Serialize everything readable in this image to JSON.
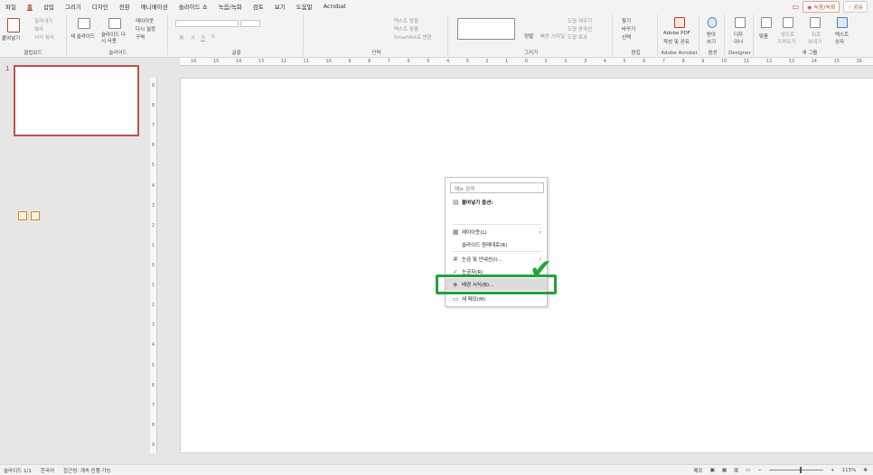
{
  "menu": {
    "tabs": [
      "파일",
      "홈",
      "삽입",
      "그리기",
      "디자인",
      "전환",
      "애니메이션",
      "슬라이드 쇼",
      "녹음/녹화",
      "검토",
      "보기",
      "도움말",
      "Acrobat"
    ],
    "active_index": 1,
    "record_button": "◉ 녹음/녹화",
    "share_button": "☝ 공유",
    "comment_icon": "comment-icon"
  },
  "ribbon": {
    "clipboard": {
      "paste": "붙여넣기",
      "cut": "잘라내기",
      "copy": "복사",
      "format_painter": "서식 복사",
      "label": "클립보드"
    },
    "slides": {
      "new_slide": "새 슬라이드",
      "reuse": "슬라이드 다시 사용",
      "layout": "레이아웃",
      "reset": "다시 설정",
      "section": "구역",
      "label": "슬라이드"
    },
    "font": {
      "label": "글꼴",
      "bold": "가",
      "italic": "가",
      "underline": "가",
      "strike": "S"
    },
    "paragraph": {
      "text_direction": "텍스트 방향",
      "align_text": "텍스트 맞춤",
      "smartart": "SmartArt로 변환",
      "label": "단락"
    },
    "drawing": {
      "arrange": "정렬",
      "quick_styles": "빠른 스타일",
      "shape_fill": "도형 채우기",
      "shape_outline": "도형 윤곽선",
      "shape_effects": "도형 효과",
      "label": "그리기"
    },
    "editing": {
      "find": "찾기",
      "replace": "바꾸기",
      "select": "선택",
      "label": "편집"
    },
    "acrobat": {
      "create_pdf": "Adobe PDF",
      "create_share": "작성 및 공유",
      "label": "Adobe Acrobat"
    },
    "voice": {
      "dictate": "받아",
      "dictate2": "쓰기",
      "label": "음성"
    },
    "designer": {
      "designer": "디자",
      "designer2": "이너",
      "label": "Designer"
    },
    "new_group": {
      "fit": "맞춤",
      "bring_forward": "앞으로",
      "bring_forward2": "가져오기",
      "send_back": "뒤로",
      "send_back2": "보내기",
      "textbox": "텍스트",
      "textbox2": "상자",
      "label": "새 그룹"
    }
  },
  "ruler_h": [
    "16",
    "15",
    "14",
    "13",
    "12",
    "11",
    "10",
    "9",
    "8",
    "7",
    "6",
    "5",
    "4",
    "3",
    "2",
    "1",
    "0",
    "1",
    "2",
    "3",
    "4",
    "5",
    "6",
    "7",
    "8",
    "9",
    "10",
    "11",
    "12",
    "13",
    "14",
    "15",
    "16"
  ],
  "ruler_v": [
    "9",
    "8",
    "7",
    "6",
    "5",
    "4",
    "3",
    "2",
    "1",
    "0",
    "1",
    "2",
    "3",
    "4",
    "5",
    "6",
    "7",
    "8",
    "9"
  ],
  "thumbnail": {
    "number": "1"
  },
  "context_menu": {
    "search_placeholder": "메뉴 검색",
    "paste_options": "붙여넣기 옵션:",
    "layout": "레이아웃(L)",
    "reset_slide": "슬라이드 원래대로(R)",
    "grid_guides": "눈금 및 안내선(I)...",
    "ruler": "눈금자(R)",
    "format_background": "배경 서식(B)...",
    "new_comment": "새 메모(M)"
  },
  "status": {
    "slide_count": "슬라이드 1/1",
    "language": "한국어",
    "accessibility": "접근성: 계속 진행 가능",
    "notes": "메모",
    "zoom": "115%"
  },
  "colors": {
    "accent": "#b7472a",
    "highlight": "#22a33b",
    "thumb_border": "#c0504d"
  }
}
